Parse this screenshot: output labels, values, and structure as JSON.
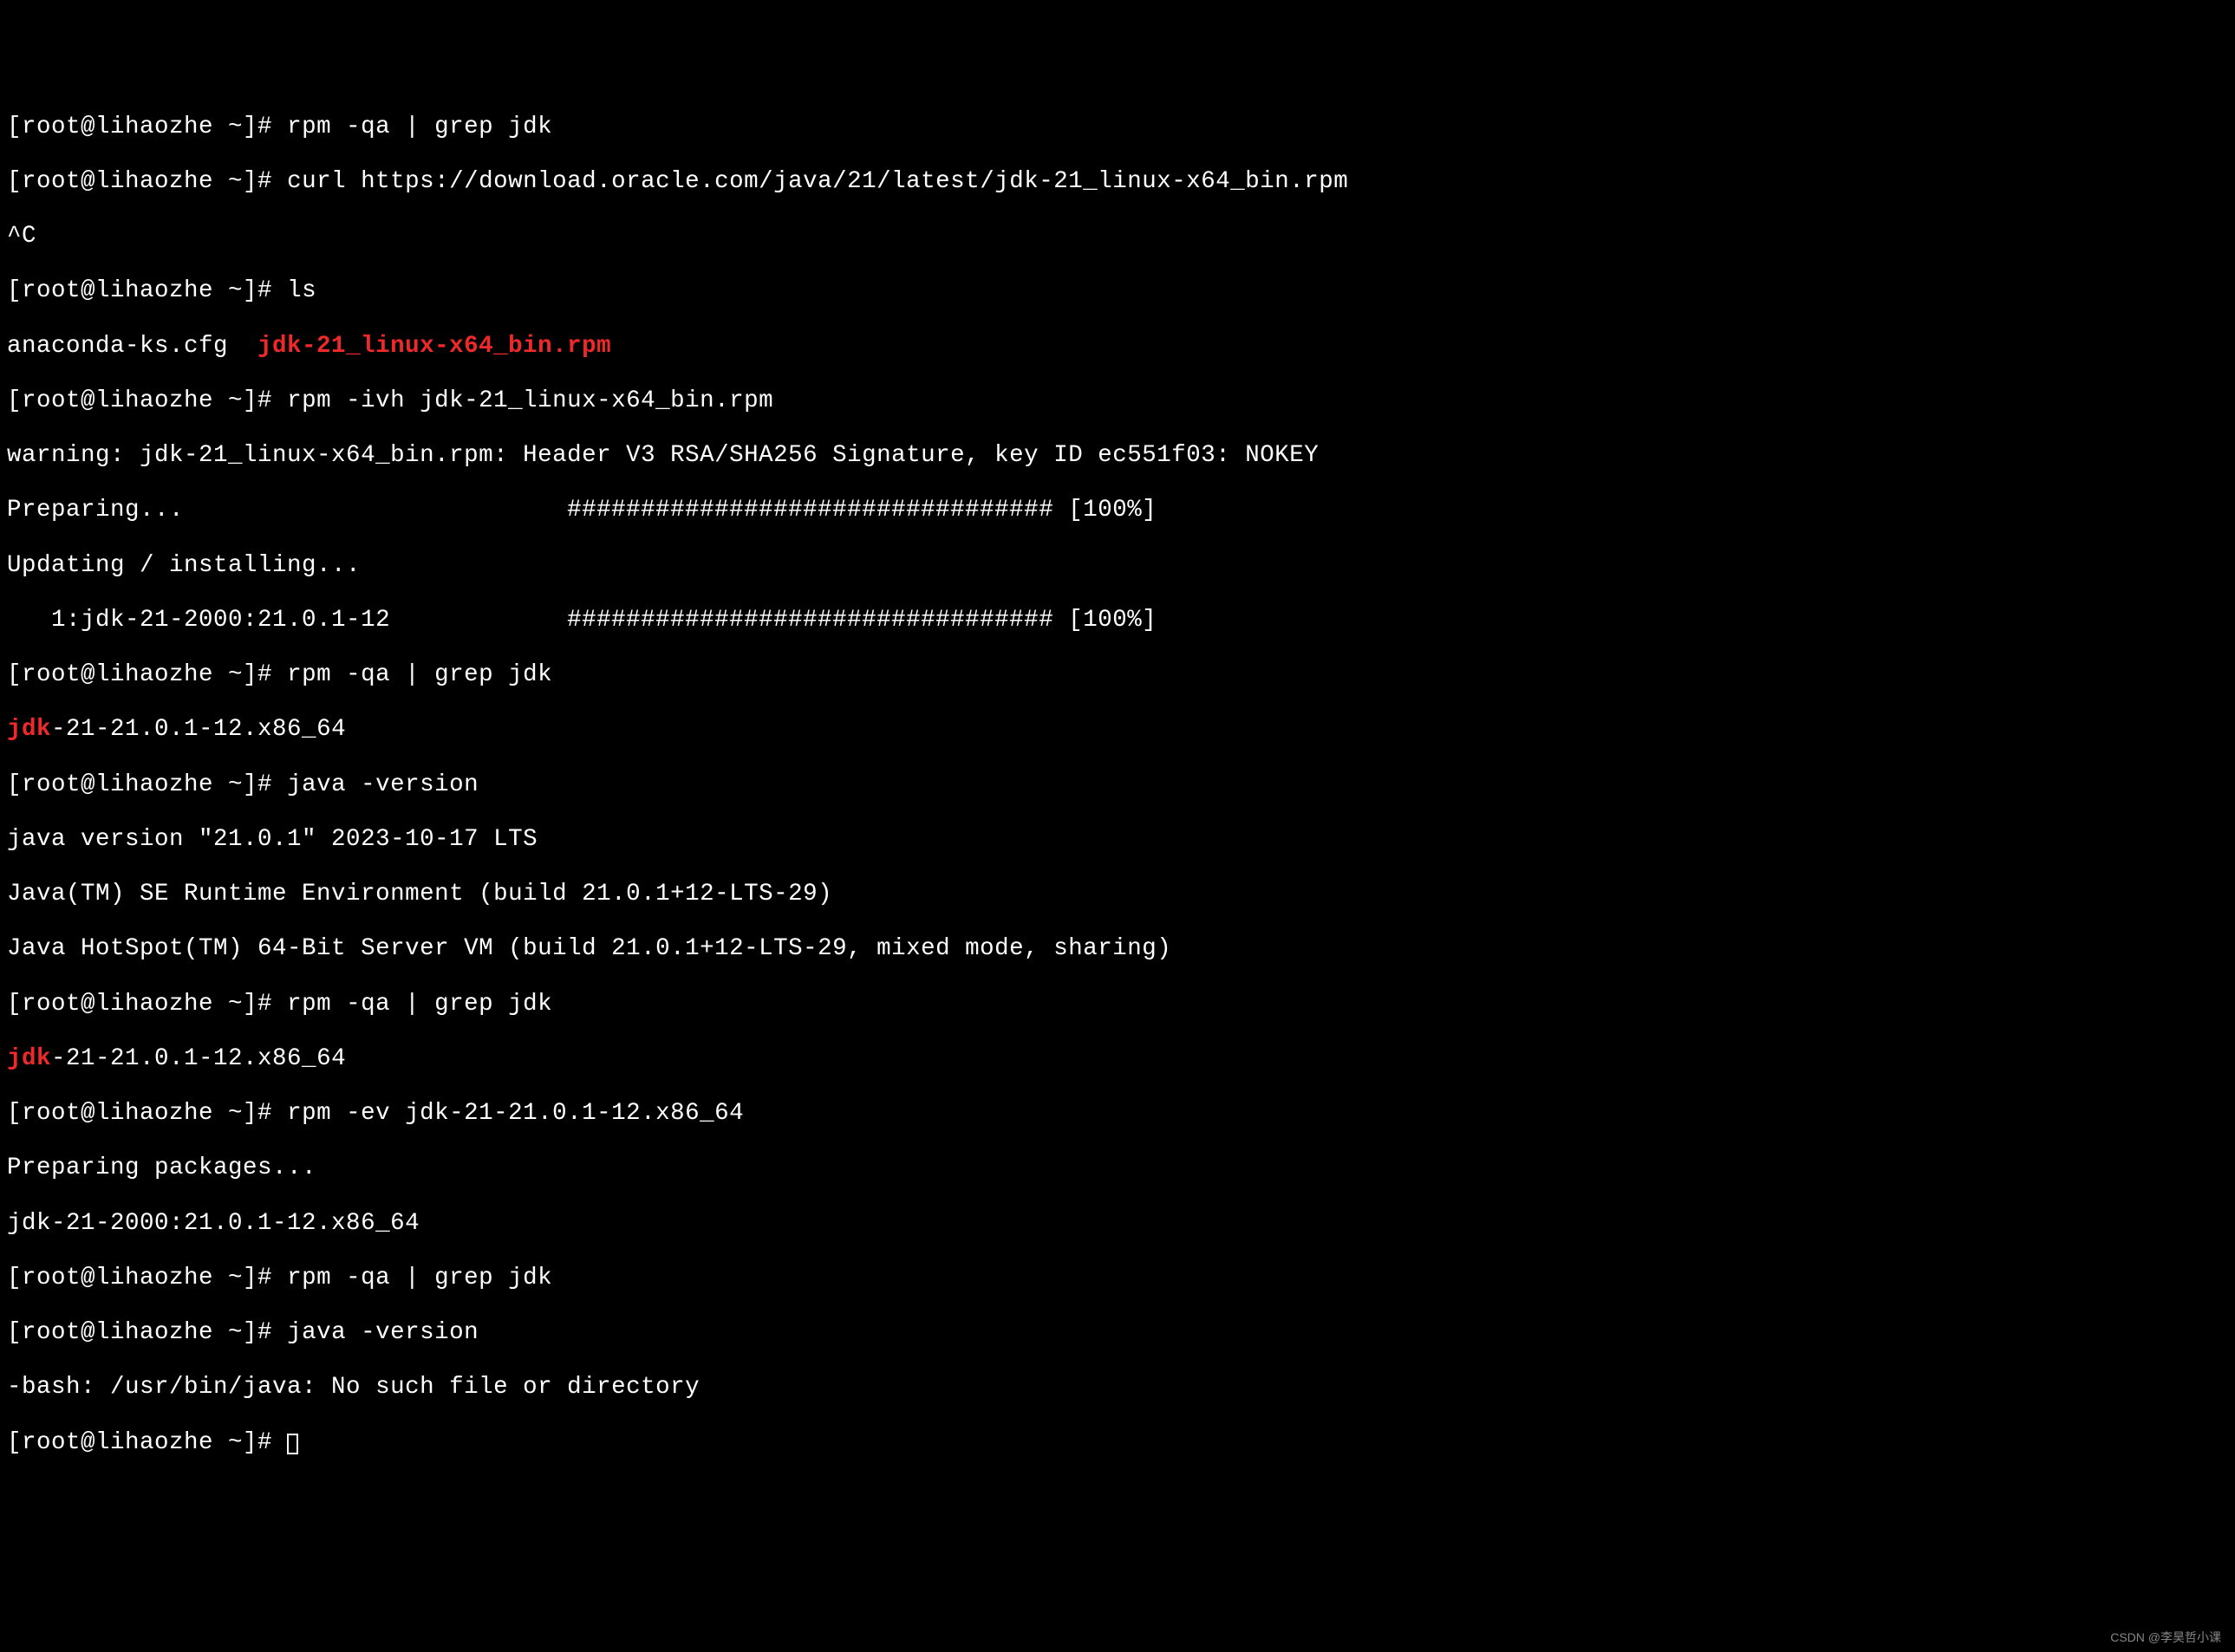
{
  "prompt": "[root@lihaozhe ~]# ",
  "lines": {
    "l1_cmd": "rpm -qa | grep jdk",
    "l2_cmd": "curl https://download.oracle.com/java/21/latest/jdk-21_linux-x64_bin.rpm",
    "l3": "^C",
    "l4_cmd": "ls",
    "l5_a": "anaconda-ks.cfg  ",
    "l5_b": "jdk-21_linux-x64_bin.rpm",
    "l6_cmd": "rpm -ivh jdk-21_linux-x64_bin.rpm",
    "l7": "warning: jdk-21_linux-x64_bin.rpm: Header V3 RSA/SHA256 Signature, key ID ec551f03: NOKEY",
    "l8": "Preparing...                          ################################# [100%]",
    "l9": "Updating / installing...",
    "l10": "   1:jdk-21-2000:21.0.1-12            ################################# [100%]",
    "l11_cmd": "rpm -qa | grep jdk",
    "l12_a": "jdk",
    "l12_b": "-21-21.0.1-12.x86_64",
    "l13_cmd": "java -version",
    "l14": "java version \"21.0.1\" 2023-10-17 LTS",
    "l15": "Java(TM) SE Runtime Environment (build 21.0.1+12-LTS-29)",
    "l16": "Java HotSpot(TM) 64-Bit Server VM (build 21.0.1+12-LTS-29, mixed mode, sharing)",
    "l17_cmd": "rpm -qa | grep jdk",
    "l18_a": "jdk",
    "l18_b": "-21-21.0.1-12.x86_64",
    "l19_cmd": "rpm -ev jdk-21-21.0.1-12.x86_64",
    "l20": "Preparing packages...",
    "l21": "jdk-21-2000:21.0.1-12.x86_64",
    "l22_cmd": "rpm -qa | grep jdk",
    "l23_cmd": "java -version",
    "l24": "-bash: /usr/bin/java: No such file or directory"
  },
  "watermark": "CSDN @李昊哲小课"
}
